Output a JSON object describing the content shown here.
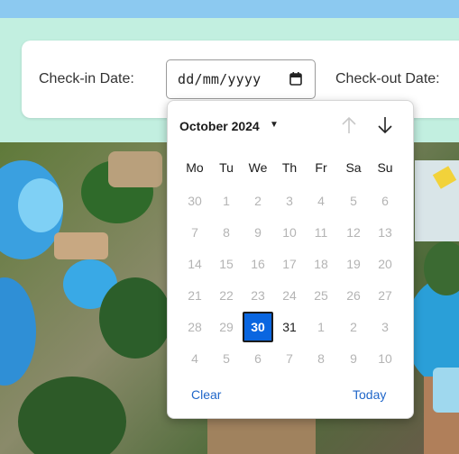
{
  "form": {
    "checkin_label": "Check-in Date:",
    "checkin_value": "dd/mm/yyyy",
    "checkout_label": "Check-out Date:"
  },
  "calendar": {
    "month_label": "October 2024",
    "weekdays": [
      "Mo",
      "Tu",
      "We",
      "Th",
      "Fr",
      "Sa",
      "Su"
    ],
    "weeks": [
      [
        "30",
        "1",
        "2",
        "3",
        "4",
        "5",
        "6"
      ],
      [
        "7",
        "8",
        "9",
        "10",
        "11",
        "12",
        "13"
      ],
      [
        "14",
        "15",
        "16",
        "17",
        "18",
        "19",
        "20"
      ],
      [
        "21",
        "22",
        "23",
        "24",
        "25",
        "26",
        "27"
      ],
      [
        "28",
        "29",
        "30",
        "31",
        "1",
        "2",
        "3"
      ],
      [
        "4",
        "5",
        "6",
        "7",
        "8",
        "9",
        "10"
      ]
    ],
    "selected": "30",
    "clear_label": "Clear",
    "today_label": "Today"
  },
  "icons": {
    "date_picker": "calendar-icon",
    "month_dropdown": "caret-down-icon",
    "previous": "arrow-up-icon",
    "next": "arrow-down-icon"
  },
  "colors": {
    "header_strip": "#8cc9f0",
    "background": "#c2efe0",
    "selected_day": "#0a66e0",
    "link": "#1f66c9"
  }
}
